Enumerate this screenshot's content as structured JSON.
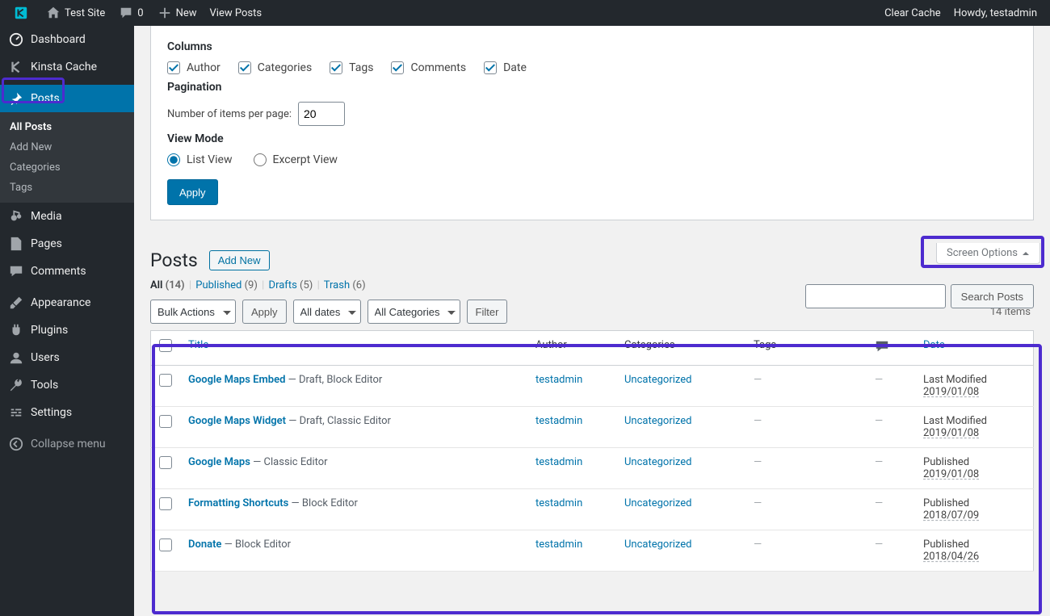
{
  "adminbar": {
    "site_name": "Test Site",
    "comment_count": "0",
    "new_label": "New",
    "view_posts_label": "View Posts",
    "clear_cache_label": "Clear Cache",
    "howdy_label": "Howdy, testadmin"
  },
  "sidebar": {
    "items": [
      {
        "label": "Dashboard",
        "icon": "dashboard"
      },
      {
        "label": "Kinsta Cache",
        "icon": "kinsta"
      },
      {
        "label": "Posts",
        "icon": "pin",
        "current": true
      },
      {
        "label": "Media",
        "icon": "media"
      },
      {
        "label": "Pages",
        "icon": "page"
      },
      {
        "label": "Comments",
        "icon": "comment"
      },
      {
        "label": "Appearance",
        "icon": "brush"
      },
      {
        "label": "Plugins",
        "icon": "plugin"
      },
      {
        "label": "Users",
        "icon": "users"
      },
      {
        "label": "Tools",
        "icon": "tool"
      },
      {
        "label": "Settings",
        "icon": "settings"
      },
      {
        "label": "Collapse menu",
        "icon": "collapse"
      }
    ],
    "posts_submenu": [
      "All Posts",
      "Add New",
      "Categories",
      "Tags"
    ]
  },
  "screen_options": {
    "columns_heading": "Columns",
    "columns": [
      "Author",
      "Categories",
      "Tags",
      "Comments",
      "Date"
    ],
    "pagination_heading": "Pagination",
    "per_page_label": "Number of items per page:",
    "per_page_value": "20",
    "view_mode_heading": "View Mode",
    "view_list_label": "List View",
    "view_excerpt_label": "Excerpt View",
    "apply_label": "Apply",
    "tab_label": "Screen Options"
  },
  "page": {
    "title": "Posts",
    "add_new_label": "Add New",
    "filters": {
      "all_label": "All",
      "all_count": "(14)",
      "published_label": "Published",
      "published_count": "(9)",
      "drafts_label": "Drafts",
      "drafts_count": "(5)",
      "trash_label": "Trash",
      "trash_count": "(6)"
    },
    "bulk_actions_label": "Bulk Actions",
    "bulk_apply_label": "Apply",
    "date_filter_label": "All dates",
    "cat_filter_label": "All Categories",
    "filter_btn_label": "Filter",
    "item_count_label": "14 items",
    "search_btn_label": "Search Posts"
  },
  "table": {
    "headers": {
      "title": "Title",
      "author": "Author",
      "categories": "Categories",
      "tags": "Tags",
      "date": "Date"
    },
    "rows": [
      {
        "title": "Google Maps Embed",
        "state": " — Draft, Block Editor",
        "author": "testadmin",
        "category": "Uncategorized",
        "tags": "—",
        "comments": "—",
        "date_status": "Last Modified",
        "date": "2019/01/08"
      },
      {
        "title": "Google Maps Widget",
        "state": " — Draft, Classic Editor",
        "author": "testadmin",
        "category": "Uncategorized",
        "tags": "—",
        "comments": "—",
        "date_status": "Last Modified",
        "date": "2019/01/08"
      },
      {
        "title": "Google Maps",
        "state": " — Classic Editor",
        "author": "testadmin",
        "category": "Uncategorized",
        "tags": "—",
        "comments": "—",
        "date_status": "Published",
        "date": "2019/01/08"
      },
      {
        "title": "Formatting Shortcuts",
        "state": " — Block Editor",
        "author": "testadmin",
        "category": "Uncategorized",
        "tags": "—",
        "comments": "—",
        "date_status": "Published",
        "date": "2018/07/09"
      },
      {
        "title": "Donate",
        "state": " — Block Editor",
        "author": "testadmin",
        "category": "Uncategorized",
        "tags": "—",
        "comments": "—",
        "date_status": "Published",
        "date": "2018/04/26"
      }
    ]
  }
}
